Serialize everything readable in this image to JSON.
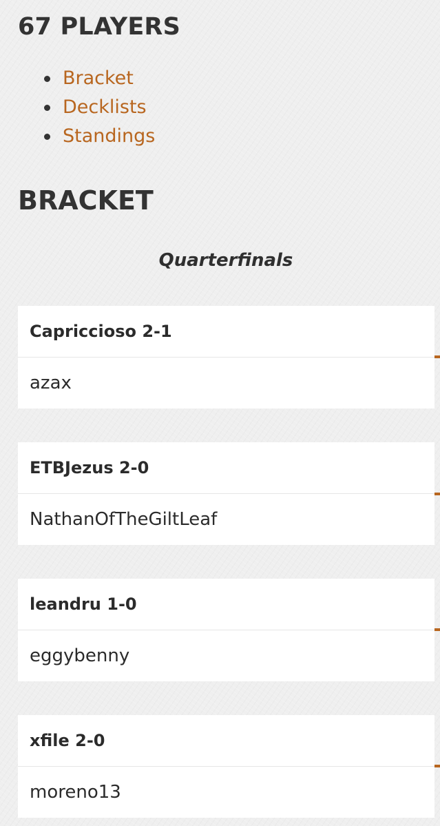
{
  "header": {
    "players_title": "67 PLAYERS"
  },
  "nav": {
    "items": [
      {
        "label": "Bracket"
      },
      {
        "label": "Decklists"
      },
      {
        "label": "Standings"
      }
    ]
  },
  "bracket": {
    "title": "BRACKET",
    "round_title": "Quarterfinals",
    "matches": [
      {
        "winner": "Capriccioso 2-1",
        "loser": "azax"
      },
      {
        "winner": "ETBJezus 2-0",
        "loser": "NathanOfTheGiltLeaf"
      },
      {
        "winner": "leandru 1-0",
        "loser": "eggybenny"
      },
      {
        "winner": "xfile 2-0",
        "loser": "moreno13"
      }
    ]
  },
  "colors": {
    "link": "#b8661f",
    "connector": "#b8661f",
    "background": "#efefef",
    "card": "#ffffff"
  }
}
